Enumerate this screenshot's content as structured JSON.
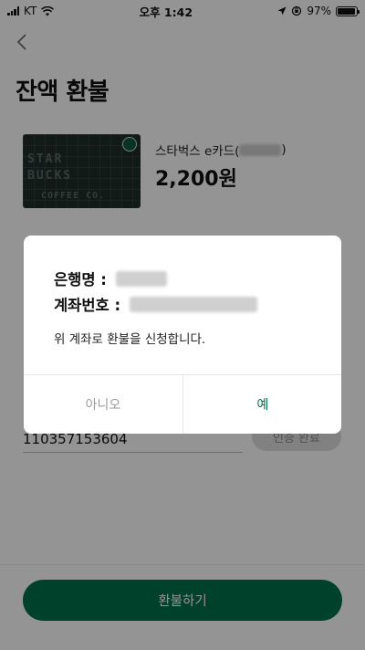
{
  "status_bar": {
    "carrier": "KT",
    "time": "오후 1:42",
    "battery": "97%",
    "battery_level": 0.97
  },
  "header": {
    "title": "잔액 환불"
  },
  "card": {
    "name": "스타벅스 e카드(",
    "name_suffix": ")",
    "balance": "2,200원",
    "image_text_line1": "STAR",
    "image_text_line2": "BUCKS",
    "image_text_line3": "COFFEE CO."
  },
  "form": {
    "account_number": "110357153604",
    "verify_label": "인증 완료"
  },
  "dialog": {
    "bank_label": "은행명 :",
    "account_label": "계좌번호 :",
    "message": "위 계좌로 환불을 신청합니다.",
    "no_label": "아니오",
    "yes_label": "예"
  },
  "bottom": {
    "refund_label": "환불하기"
  },
  "colors": {
    "brand_green": "#00704a",
    "overlay": "rgba(0,0,0,0.42)"
  }
}
